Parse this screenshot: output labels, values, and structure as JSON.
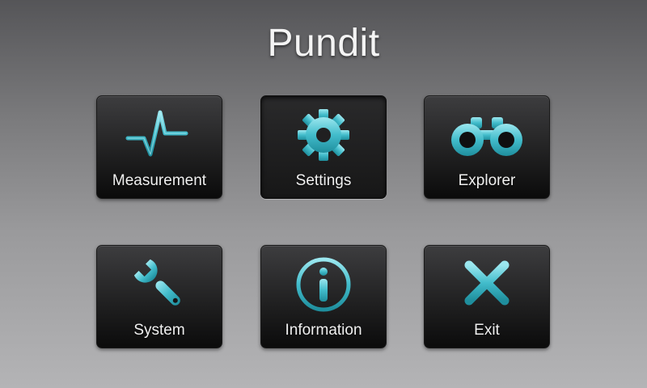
{
  "app": {
    "title": "Pundit"
  },
  "theme": {
    "accent": "#3fb9c8",
    "accent_light": "#8fe3ec",
    "tile_text": "#f0f0f0"
  },
  "menu": {
    "selected": "Settings",
    "items": [
      {
        "label": "Measurement",
        "icon": "waveform-icon"
      },
      {
        "label": "Settings",
        "icon": "gear-icon"
      },
      {
        "label": "Explorer",
        "icon": "binoculars-icon"
      },
      {
        "label": "System",
        "icon": "wrench-icon"
      },
      {
        "label": "Information",
        "icon": "info-icon"
      },
      {
        "label": "Exit",
        "icon": "close-icon"
      }
    ]
  }
}
